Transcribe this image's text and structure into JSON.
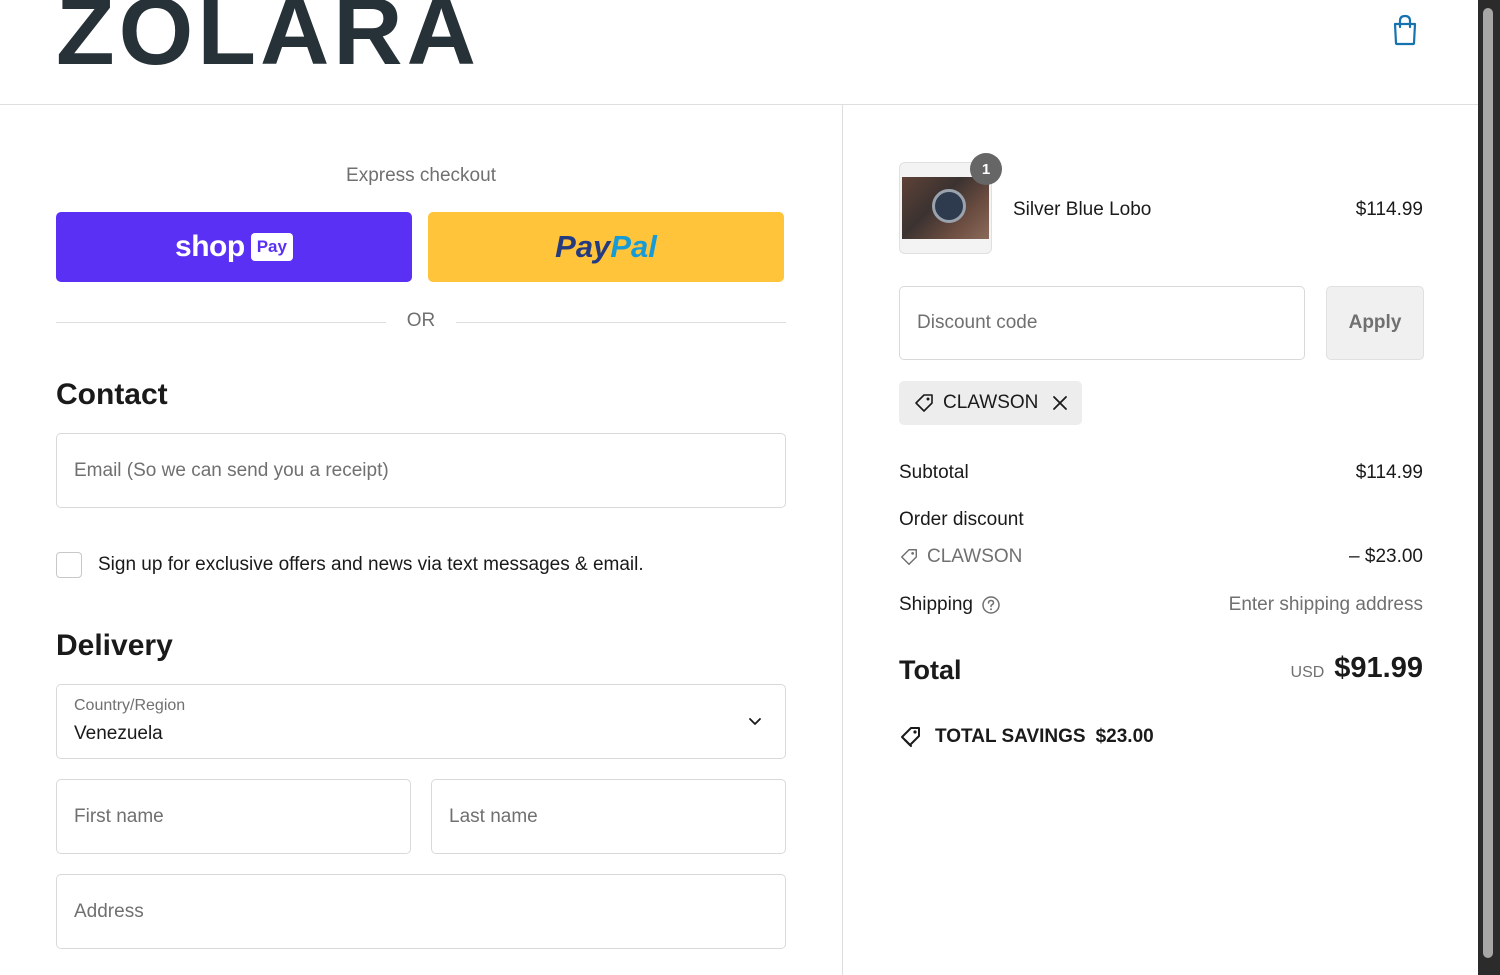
{
  "header": {
    "logo_text": "ZOLARA",
    "cart_icon": "shopping-bag-icon"
  },
  "express": {
    "title": "Express checkout",
    "shop_pay": {
      "word": "shop",
      "badge": "Pay"
    },
    "paypal": {
      "part1": "Pay",
      "part2": "Pal"
    },
    "or_text": "OR"
  },
  "contact": {
    "title": "Contact",
    "email_placeholder": "Email (So we can send you a receipt)",
    "newsletter_label": "Sign up for exclusive offers and news via text messages & email."
  },
  "delivery": {
    "title": "Delivery",
    "country_label": "Country/Region",
    "country_value": "Venezuela",
    "first_name_placeholder": "First name",
    "last_name_placeholder": "Last name",
    "address_placeholder": "Address"
  },
  "summary": {
    "item": {
      "name": "Silver Blue Lobo",
      "price": "$114.99",
      "quantity": "1"
    },
    "discount_placeholder": "Discount code",
    "apply_label": "Apply",
    "applied_code": "CLAWSON",
    "subtotal_label": "Subtotal",
    "subtotal_value": "$114.99",
    "order_discount_label": "Order discount",
    "discount_code": "CLAWSON",
    "discount_value": "– $23.00",
    "shipping_label": "Shipping",
    "shipping_value": "Enter shipping address",
    "total_label": "Total",
    "total_currency": "USD",
    "total_value": "$91.99",
    "savings_label": "TOTAL SAVINGS",
    "savings_value": "$23.00"
  },
  "colors": {
    "shop_pay": "#5a31f4",
    "paypal": "#ffc439",
    "paypal_dark": "#253b80",
    "paypal_light": "#179bd7",
    "accent": "#1773b0"
  }
}
